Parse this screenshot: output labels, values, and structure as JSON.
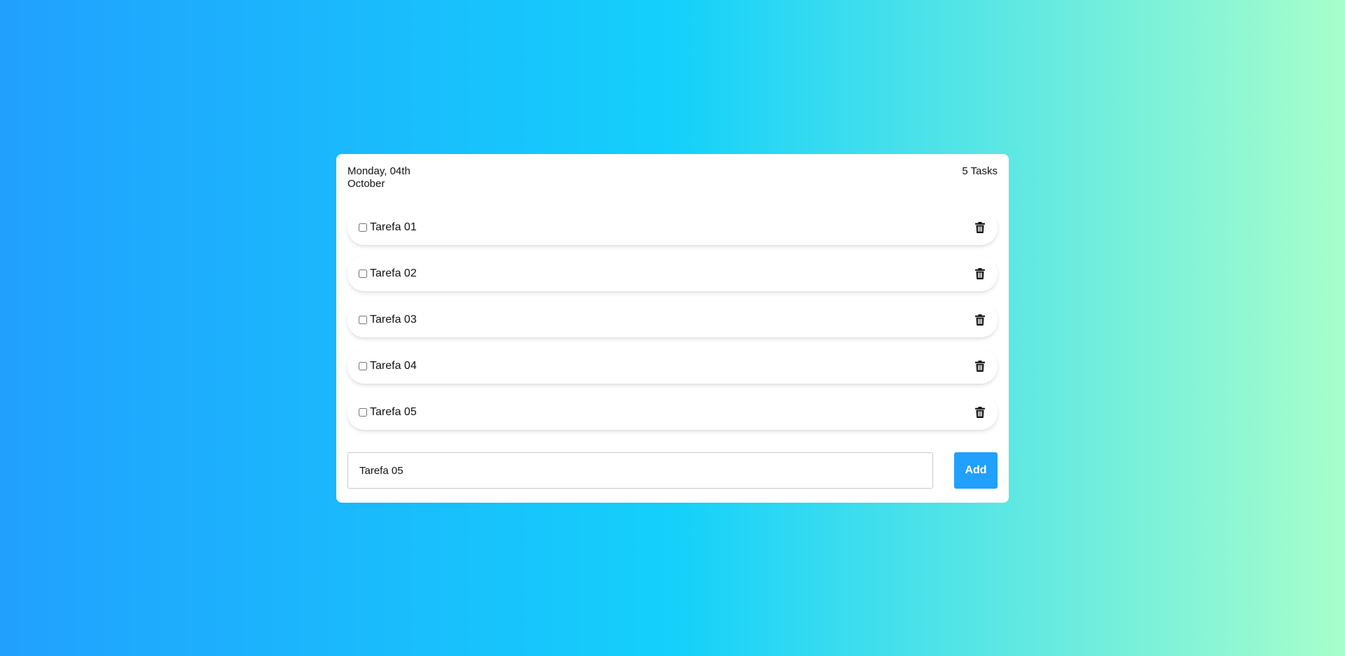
{
  "header": {
    "date": "Monday, 04th October",
    "task_count": "5 Tasks"
  },
  "tasks": [
    {
      "label": "Tarefa 01",
      "done": false
    },
    {
      "label": "Tarefa 02",
      "done": false
    },
    {
      "label": "Tarefa 03",
      "done": false
    },
    {
      "label": "Tarefa 04",
      "done": false
    },
    {
      "label": "Tarefa 05",
      "done": false
    }
  ],
  "form": {
    "input_value": "Tarefa 05",
    "add_label": "Add"
  },
  "icons": {
    "delete": "trash-icon"
  },
  "colors": {
    "accent": "#21a0fe",
    "gradient_start": "#21a0fe",
    "gradient_mid": "#14d0fb",
    "gradient_end": "#a7ffcb"
  }
}
